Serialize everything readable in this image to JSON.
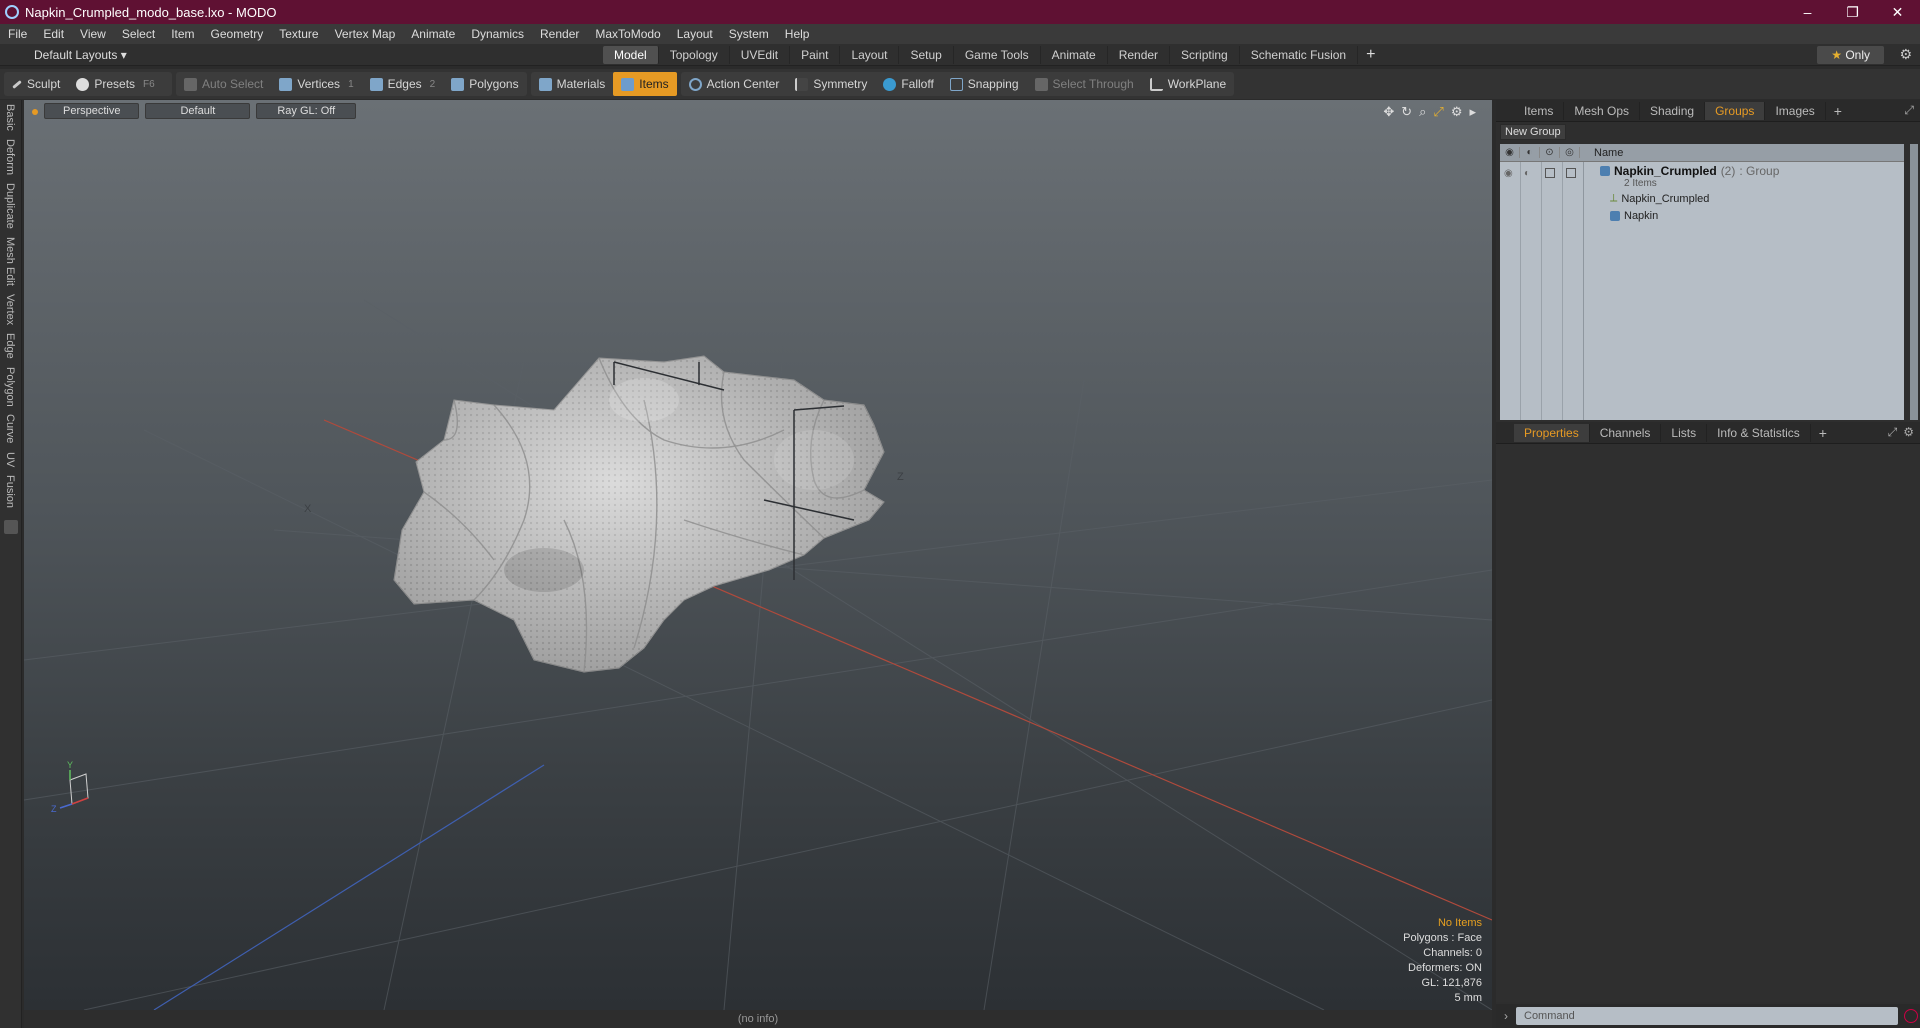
{
  "window": {
    "title": "Napkin_Crumpled_modo_base.lxo - MODO",
    "minimize": "–",
    "restore": "❐",
    "close": "✕"
  },
  "menu": [
    "File",
    "Edit",
    "View",
    "Select",
    "Item",
    "Geometry",
    "Texture",
    "Vertex Map",
    "Animate",
    "Dynamics",
    "Render",
    "MaxToModo",
    "Layout",
    "System",
    "Help"
  ],
  "layouts": {
    "selector": "Default Layouts",
    "tabs": [
      "Model",
      "Topology",
      "UVEdit",
      "Paint",
      "Layout",
      "Setup",
      "Game Tools",
      "Animate",
      "Render",
      "Scripting",
      "Schematic Fusion"
    ],
    "active": "Model",
    "only": "Only"
  },
  "toolbar": {
    "sculpt": "Sculpt",
    "presets": "Presets",
    "presets_key": "F6",
    "auto_select": "Auto Select",
    "vertices": "Vertices",
    "vertices_key": "1",
    "edges": "Edges",
    "edges_key": "2",
    "polygons": "Polygons",
    "materials": "Materials",
    "items": "Items",
    "action_center": "Action Center",
    "symmetry": "Symmetry",
    "falloff": "Falloff",
    "snapping": "Snapping",
    "select_through": "Select Through",
    "workplane": "WorkPlane"
  },
  "left_tabs": [
    "Basic",
    "Deform",
    "Duplicate",
    "Mesh Edit",
    "Vertex",
    "Edge",
    "Polygon",
    "Curve",
    "UV",
    "Fusion"
  ],
  "viewport": {
    "view": "Perspective",
    "shading": "Default",
    "raygl": "Ray GL: Off",
    "axis_labels": {
      "x": "X",
      "y": "Y",
      "z": "Z"
    },
    "stats": {
      "no_items": "No Items",
      "polygons": "Polygons : Face",
      "channels": "Channels: 0",
      "deformers": "Deformers: ON",
      "gl": "GL: 121,876",
      "unit": "5 mm"
    },
    "status": "(no info)"
  },
  "top_panel": {
    "tabs": [
      "Items",
      "Mesh Ops",
      "Shading",
      "Groups",
      "Images"
    ],
    "active": "Groups",
    "new_group": "New Group",
    "column_name": "Name",
    "group": {
      "name": "Napkin_Crumpled",
      "count": "(2)",
      "type": ": Group",
      "items_label": "2 Items",
      "children": [
        "Napkin_Crumpled",
        "Napkin"
      ]
    }
  },
  "bottom_panel": {
    "tabs": [
      "Properties",
      "Channels",
      "Lists",
      "Info & Statistics"
    ],
    "active": "Properties"
  },
  "command": {
    "placeholder": "Command"
  },
  "colors": {
    "accent": "#e69a24",
    "titlebar": "#5f1133"
  }
}
